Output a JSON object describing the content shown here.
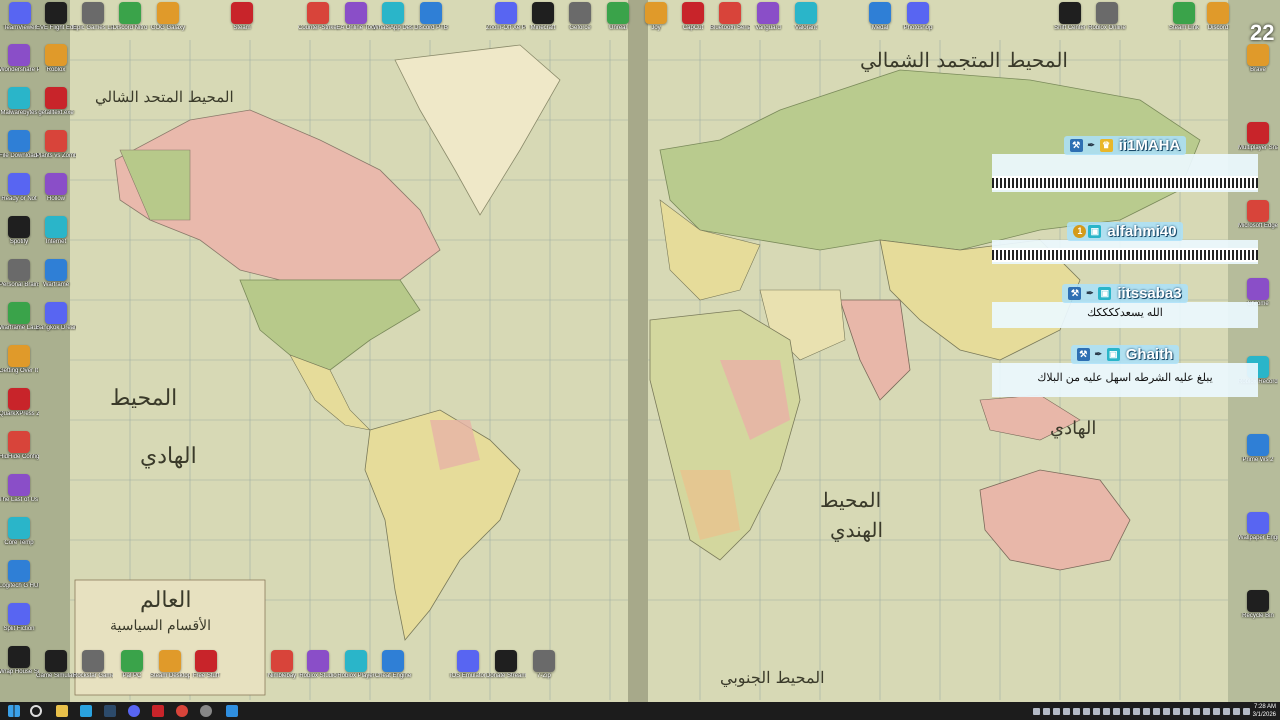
{
  "wallpaper": {
    "ocean_labels": [
      "المحيط المتجمد الشمالي",
      "المحيط المتحد الشالي",
      "المحيط",
      "الهادي",
      "المحيط",
      "الهندي",
      "المحيط الجنوبي",
      "الهادي"
    ],
    "cartouche": [
      "العالم",
      "الأقسام السياسية"
    ]
  },
  "desktop_icons": {
    "top_row": [
      "TeamViewer",
      "EVE Flight Editor Demo",
      "Epic Games Launcher",
      "Discord Nitro",
      "GOG Galaxy",
      "Steam",
      "Counter-Strike 2 Simulator",
      "EA Online Tool",
      "WhatsApp Desktop",
      "Discord PTB",
      "Zoom-Off Xe People",
      "Minecraft",
      "Geforce",
      "Unreal",
      "Joy",
      "CapCut",
      "Bluetooth Serial",
      "Vanguard",
      "Valorant",
      "Medal",
      "Photoshop",
      "Shift Center",
      "Roblox Online",
      "Steam Link",
      "Discord"
    ],
    "left_col": [
      "Wondershare PDFelement",
      "Malwarebytes",
      "File Downloader",
      "Ready or Not",
      "Spotify",
      "Personal Brains",
      "Warframe Launcher",
      "Getting Over It with Bennett",
      "QuarkXPress Zone",
      "HidHide Configuration",
      "The Last of Us Part II",
      "Core Temp",
      "Logitech G HUB",
      "Split Fiction",
      "Wrap House Simulator"
    ],
    "left_col2": [
      "Roblox",
      "getalltext.exe",
      "Plants vs Zombies",
      "Hollow",
      "Internet",
      "Warframe",
      "Bangkok Dream"
    ],
    "bottom_row": [
      "Game Simulator",
      "Rockstar Games Launcher",
      "Pal PC",
      "Steam Desktop Authenticator",
      "Free Stuff",
      "Nimblebay",
      "Roblox Studio",
      "Roblox Player",
      "Cheat Engine",
      "iOS Emulator",
      "Donate Stream",
      "7-Zip"
    ],
    "right_col": [
      "Brave",
      "Multiplayer Snake",
      "Microsoft Edge",
      "Chrome",
      "Roblox Record Settings",
      "Prime Ws 2",
      "Wallpaper Engine",
      "Recycle Bin"
    ]
  },
  "chat": [
    {
      "user": "ii1MAHA",
      "message": "",
      "spam": true
    },
    {
      "user": "alfahmi40",
      "message": "",
      "spam": true
    },
    {
      "user": "iitssaba3",
      "message": "الله يسعدككككك",
      "spam": false
    },
    {
      "user": "Ghaith",
      "message": "يبلغ عليه الشرطه اسهل عليه من البلاك",
      "spam": false
    }
  ],
  "overlay_counter": "22",
  "clock": {
    "time": "7:28 AM",
    "date": "3/1/2026"
  },
  "colors": {
    "chat_header": "#aae1fa",
    "chat_body": "#ebf8ff",
    "taskbar": "#1c1c1c",
    "username": "#ffffff"
  }
}
